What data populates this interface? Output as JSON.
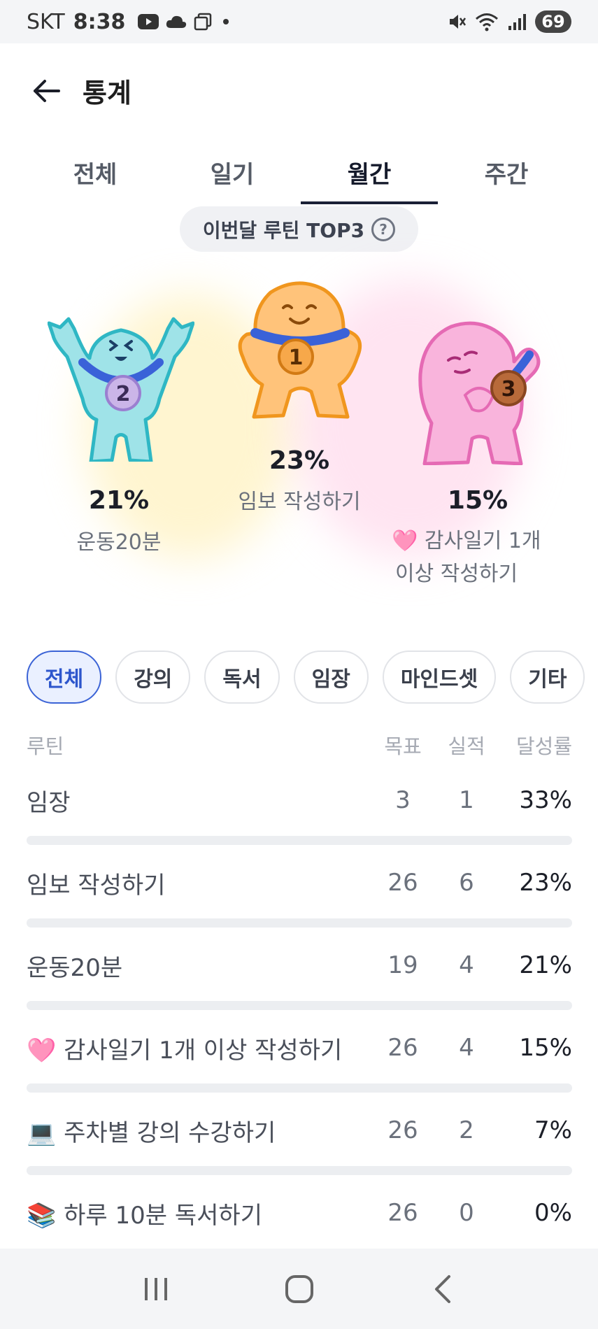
{
  "status_bar": {
    "carrier": "SKT",
    "time": "8:38",
    "battery": "69"
  },
  "header": {
    "title": "통계"
  },
  "tabs": [
    {
      "label": "전체",
      "active": false
    },
    {
      "label": "일기",
      "active": false
    },
    {
      "label": "월간",
      "active": true
    },
    {
      "label": "주간",
      "active": false
    }
  ],
  "top3": {
    "label": "이번달 루틴 TOP3",
    "help": "?",
    "ranks": [
      {
        "rank": 2,
        "percent": "21%",
        "name": "운동20분",
        "color": "#7fd8e0",
        "outline": "#2fb7c4"
      },
      {
        "rank": 1,
        "percent": "23%",
        "name": "임보 작성하기",
        "color": "#ffc37a",
        "outline": "#f0961e"
      },
      {
        "rank": 3,
        "percent": "15%",
        "name_line1": "🩷 감사일기 1개",
        "name_line2": "이상 작성하기",
        "color": "#f9a7d7",
        "outline": "#e56ab4"
      }
    ],
    "medal_numbers": [
      "2",
      "1",
      "3"
    ]
  },
  "chips": [
    {
      "label": "전체",
      "active": true
    },
    {
      "label": "강의",
      "active": false
    },
    {
      "label": "독서",
      "active": false
    },
    {
      "label": "임장",
      "active": false
    },
    {
      "label": "마인드셋",
      "active": false
    },
    {
      "label": "기타",
      "active": false
    }
  ],
  "table": {
    "headers": {
      "name": "루틴",
      "goal": "목표",
      "done": "실적",
      "rate": "달성률"
    },
    "rows": [
      {
        "name": "임장",
        "goal": "3",
        "done": "1",
        "rate": "33%",
        "progress": 0.33
      },
      {
        "name": "임보 작성하기",
        "goal": "26",
        "done": "6",
        "rate": "23%",
        "progress": 0.23
      },
      {
        "name": "운동20분",
        "goal": "19",
        "done": "4",
        "rate": "21%",
        "progress": 0.21
      },
      {
        "name": "🩷 감사일기 1개 이상 작성하기",
        "goal": "26",
        "done": "4",
        "rate": "15%",
        "progress": 0.15
      },
      {
        "name": "💻 주차별 강의 수강하기",
        "goal": "26",
        "done": "2",
        "rate": "7%",
        "progress": 0.07
      },
      {
        "name": "📚 하루 10분 독서하기",
        "goal": "26",
        "done": "0",
        "rate": "0%",
        "progress": 0.0
      }
    ]
  },
  "nav": {
    "icons": [
      "recent-apps-icon",
      "home-icon",
      "back-icon"
    ]
  }
}
